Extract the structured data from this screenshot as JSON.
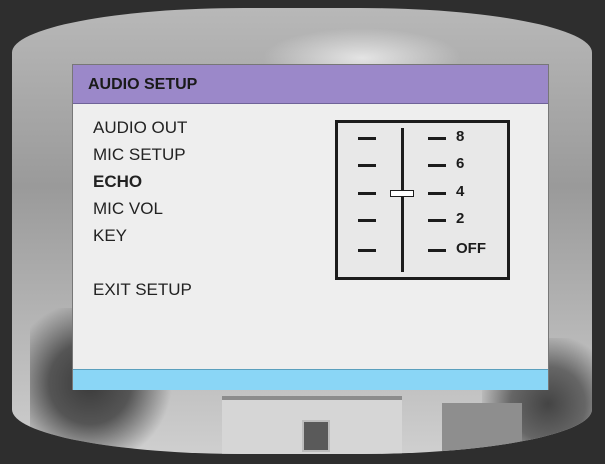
{
  "osd": {
    "title": "AUDIO SETUP",
    "menu": [
      {
        "label": "AUDIO OUT",
        "active": false
      },
      {
        "label": "MIC SETUP",
        "active": false
      },
      {
        "label": "ECHO",
        "active": true
      },
      {
        "label": "MIC VOL",
        "active": false
      },
      {
        "label": "KEY",
        "active": false
      }
    ],
    "exit_label": "EXIT SETUP",
    "echo_slider": {
      "scale_labels": [
        "8",
        "6",
        "4",
        "2",
        "OFF"
      ],
      "current_value": "4"
    },
    "colors": {
      "header": "#9b88c9",
      "footer": "#8ad6f6",
      "panel": "#eeeeee"
    }
  }
}
